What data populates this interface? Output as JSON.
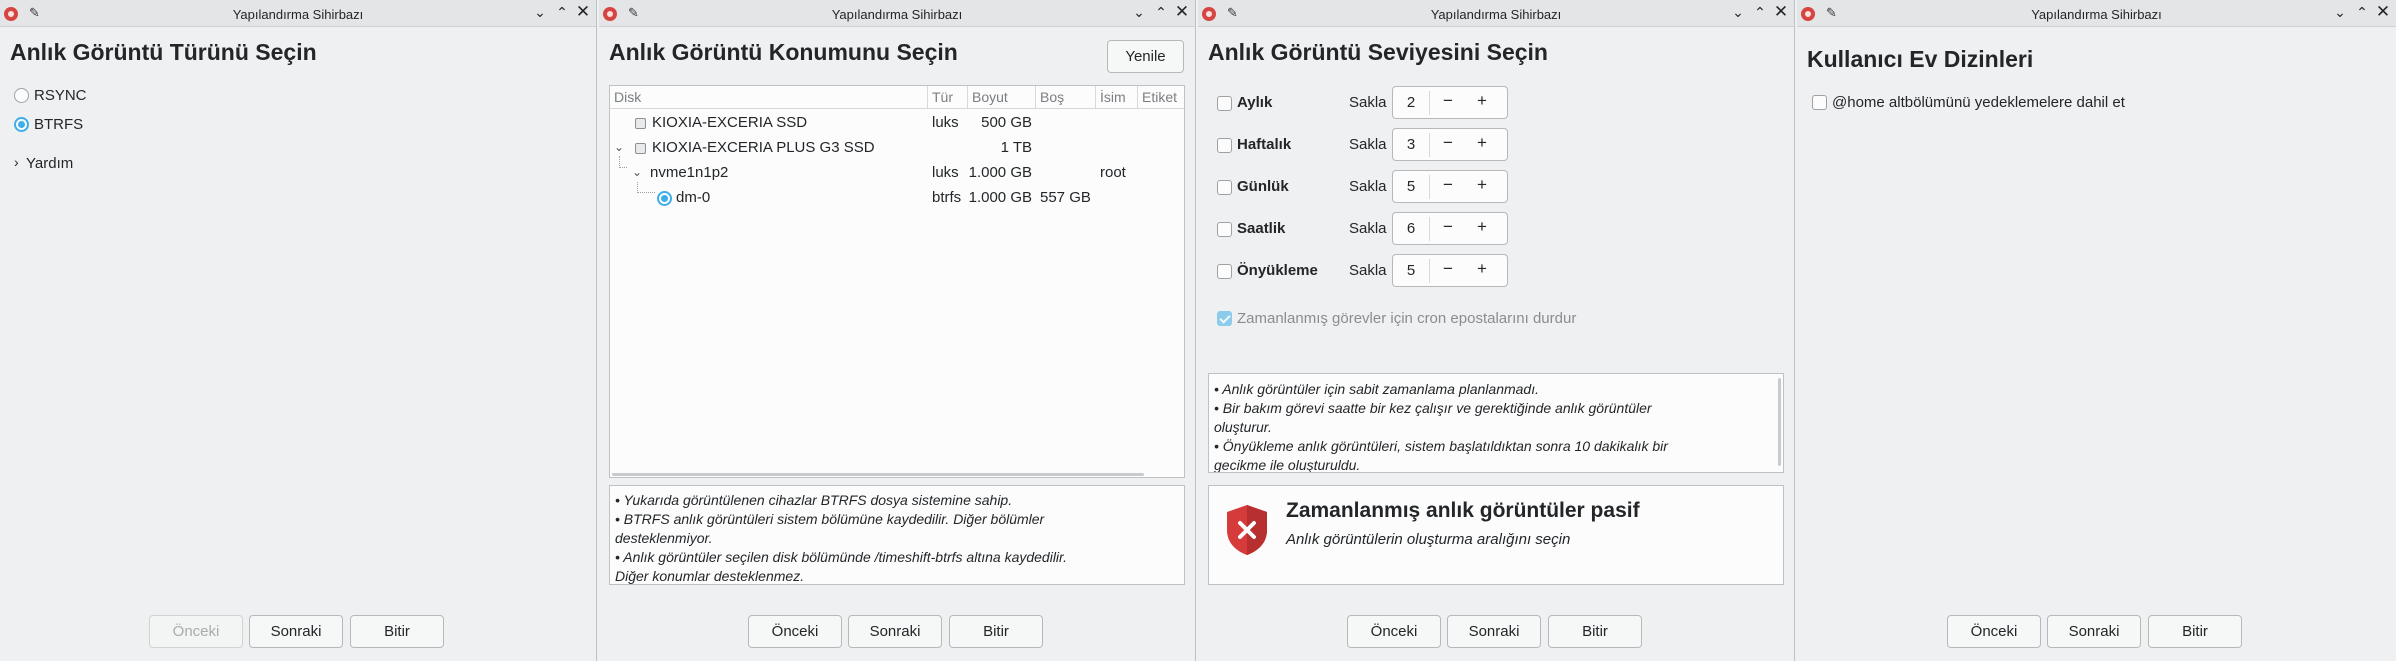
{
  "window_title": "Yapılandırma Sihirbazı",
  "title_buttons": {
    "minimize": "⌄",
    "maximize": "⌃",
    "close": "✕"
  },
  "nav": {
    "prev": "Önceki",
    "next": "Sonraki",
    "finish": "Bitir"
  },
  "win1": {
    "heading": "Anlık Görüntü Türünü Seçin",
    "options": [
      {
        "label": "RSYNC",
        "selected": false
      },
      {
        "label": "BTRFS",
        "selected": true
      }
    ],
    "help": "Yardım"
  },
  "win2": {
    "heading": "Anlık Görüntü Konumunu Seçin",
    "refresh": "Yenile",
    "columns": [
      "Disk",
      "Tür",
      "Boyut",
      "Boş",
      "İsim",
      "Etiket"
    ],
    "rows": [
      {
        "disk": "KIOXIA-EXCERIA SSD",
        "type": "luks",
        "size": "500 GB",
        "free": "",
        "name": ""
      },
      {
        "disk": "KIOXIA-EXCERIA PLUS G3 SSD",
        "type": "",
        "size": "1 TB",
        "free": "",
        "name": ""
      },
      {
        "disk": "nvme1n1p2",
        "type": "luks",
        "size": "1.000 GB",
        "free": "",
        "name": "root"
      },
      {
        "disk": "dm-0",
        "type": "btrfs",
        "size": "1.000 GB",
        "free": "557 GB",
        "name": ""
      }
    ],
    "notes": [
      "• Yukarıda görüntülenen cihazlar BTRFS dosya sistemine sahip.",
      "• BTRFS anlık görüntüleri sistem bölümüne kaydedilir. Diğer bölümler",
      "desteklenmiyor.",
      "• Anlık görüntüler seçilen disk bölümünde /timeshift-btrfs altına kaydedilir.",
      "Diğer konumlar desteklenmez."
    ]
  },
  "win3": {
    "heading": "Anlık Görüntü Seviyesini Seçin",
    "keep_label": "Sakla",
    "levels": [
      {
        "label": "Aylık",
        "keep": "2",
        "checked": false
      },
      {
        "label": "Haftalık",
        "keep": "3",
        "checked": false
      },
      {
        "label": "Günlük",
        "keep": "5",
        "checked": false
      },
      {
        "label": "Saatlik",
        "keep": "6",
        "checked": false
      },
      {
        "label": "Önyükleme",
        "keep": "5",
        "checked": false
      }
    ],
    "cron_label": "Zamanlanmış görevler için cron epostalarını durdur",
    "notes": [
      "• Anlık görüntüler için sabit zamanlama planlanmadı.",
      "• Bir bakım görevi saatte bir kez çalışır ve gerektiğinde anlık görüntüler",
      "oluşturur.",
      "• Önyükleme anlık görüntüleri, sistem başlatıldıktan sonra 10 dakikalık bir",
      "gecikme ile oluşturuldu."
    ],
    "status_title": "Zamanlanmış anlık görüntüler pasif",
    "status_sub": "Anlık görüntülerin oluşturma aralığını seçin",
    "status_color": "#d63b3b"
  },
  "win4": {
    "heading": "Kullanıcı Ev Dizinleri",
    "home_label": "@home altbölümünü yedeklemelere dahil et"
  }
}
